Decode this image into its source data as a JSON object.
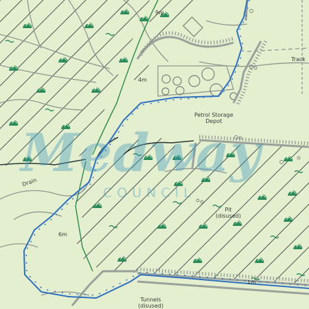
{
  "map": {
    "labels": {
      "height_9m": "9m",
      "height_4m": "4m",
      "height_6m": "6m",
      "height_1m": "1m",
      "track": "Track",
      "depot": "Petrol Storage\nDepot",
      "drain": "Drain",
      "pit": "Pit\n(disused)",
      "tunnels": "Tunnels\n(disused)"
    },
    "watermark": {
      "title": "Medway",
      "subtitle": "COUNCIL"
    },
    "colors": {
      "background": "#e4efcf",
      "hatch": "#1f2f2f",
      "tree_symbol": "#2a8a5a",
      "footpath": "#2e6fc0",
      "track_grey": "#9aa09a",
      "watermark": "#3c96be"
    }
  }
}
